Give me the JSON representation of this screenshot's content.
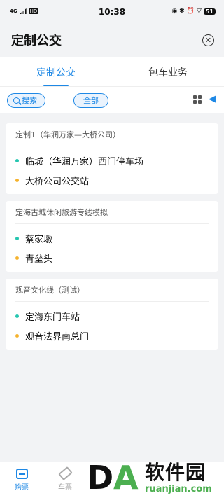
{
  "status_bar": {
    "network": "4G",
    "hd_badge": "HD",
    "time": "10:38",
    "icons": [
      "location-icon",
      "bluetooth-icon",
      "alarm-icon",
      "wifi-icon"
    ],
    "battery": "51"
  },
  "header": {
    "title": "定制公交",
    "close_icon": "close-icon"
  },
  "tabs": [
    {
      "label": "定制公交",
      "active": true
    },
    {
      "label": "包车业务",
      "active": false
    }
  ],
  "filter": {
    "search_label": "搜索",
    "all_label": "全部",
    "icons": [
      "grid-icon",
      "megaphone-icon"
    ]
  },
  "routes": [
    {
      "title": "定制1（华润万家—大桥公司）",
      "stops": [
        {
          "name": "临城（华润万家）西门停车场",
          "color": "#26c6b0"
        },
        {
          "name": "大桥公司公交站",
          "color": "#f5b22d"
        }
      ]
    },
    {
      "title": "定海古城休闲旅游专线模拟",
      "stops": [
        {
          "name": "蔡家墩",
          "color": "#26c6b0"
        },
        {
          "name": "青垒头",
          "color": "#f5b22d"
        }
      ]
    },
    {
      "title": "观音文化线（测试）",
      "stops": [
        {
          "name": "定海东门车站",
          "color": "#26c6b0"
        },
        {
          "name": "观音法界南总门",
          "color": "#f5b22d"
        }
      ]
    }
  ],
  "bottom_nav": [
    {
      "label": "购票",
      "icon": "ticket-icon",
      "active": true
    },
    {
      "label": "车票",
      "icon": "ticket-stub-icon",
      "active": false
    }
  ],
  "watermark": {
    "logo_d": "D",
    "logo_a": "A",
    "text_cn": "软件园",
    "text_en": "ruanjian.com"
  },
  "colors": {
    "accent": "#1e88e5",
    "start_dot": "#26c6b0",
    "end_dot": "#f5b22d",
    "watermark_green": "#4caf50"
  }
}
